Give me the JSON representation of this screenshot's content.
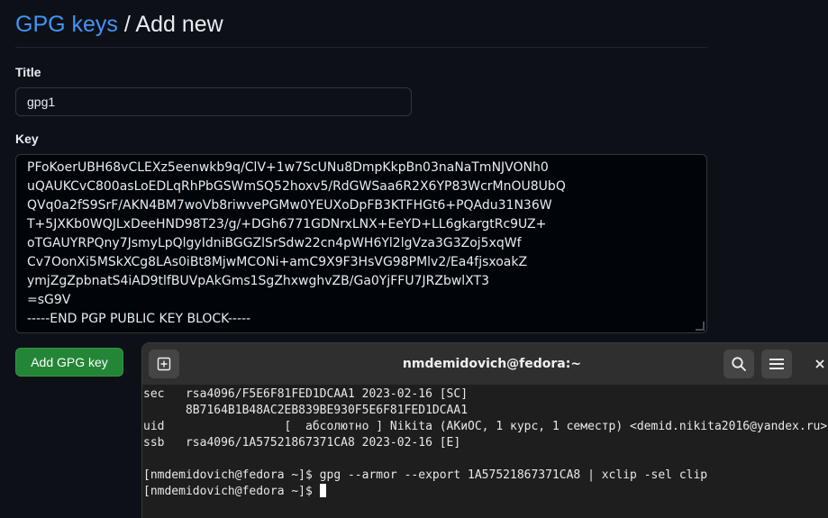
{
  "heading": {
    "link": "GPG keys",
    "separator": " / ",
    "current": "Add new"
  },
  "form": {
    "title_label": "Title",
    "title_value": "gpg1",
    "key_label": "Key",
    "key_lines": [
      "PFoKoerUBH68vCLEXz5eenwkb9q/ClV+1w7ScUNu8DmpKkpBn03naNaTmNJVONh0",
      "uQAUKCvC800asLoEDLqRhPbGSWmSQ52hoxv5/RdGWSaa6R2X6YP83WcrMnOU8UbQ",
      "QVq0a2fS9SrF/AKN4BM7woVb8riwvePGMw0YEUXoDpFB3KTFHGt6+PQAdu31N36W",
      "T+5JXKb0WQJLxDeeHND98T23/g/+DGh6771GDNrxLNX+EeYD+LL6gkargtRc9UZ+",
      "oTGAUYRPQny7JsmyLpQlgyIdniBGGZlSrSdw22cn4pWH6Yl2lgVza3G3Zoj5xqWf",
      "Cv7OonXi5MSkXCg8LAs0iBt8MjwMCONi+amC9X9F3HsVG98PMlv2/Ea4fjsxoakZ",
      "ymjZgZpbnatS4iAD9tlfBUVpAkGms1SgZhxwghvZB/Ga0YjFFU7JRZbwlXT3",
      "=sG9V",
      "-----END PGP PUBLIC KEY BLOCK-----"
    ],
    "submit_label": "Add GPG key"
  },
  "terminal": {
    "title": "nmdemidovich@fedora:~",
    "lines": [
      "sec   rsa4096/F5E6F81FED1DCAA1 2023-02-16 [SC]",
      "      8B7164B1B48AC2EB839BE930F5E6F81FED1DCAA1",
      "uid                 [  абсолютно ] Nikita (АКиОС, 1 курс, 1 семестр) <demid.nikita2016@yandex.ru>",
      "ssb   rsa4096/1A57521867371CA8 2023-02-16 [E]",
      "",
      "[nmdemidovich@fedora ~]$ gpg --armor --export 1A57521867371CA8 | xclip -sel clip"
    ],
    "prompt": "[nmdemidovich@fedora ~]$ "
  },
  "icons": {
    "new_tab": "new-tab-icon",
    "search": "search-icon",
    "menu": "hamburger-menu-icon",
    "close": "close-icon"
  },
  "colors": {
    "link": "#4493f8",
    "primary_button": "#238636",
    "background": "#0d1117",
    "terminal_bg": "#1e1e1e",
    "terminal_header": "#2f2f2f"
  }
}
